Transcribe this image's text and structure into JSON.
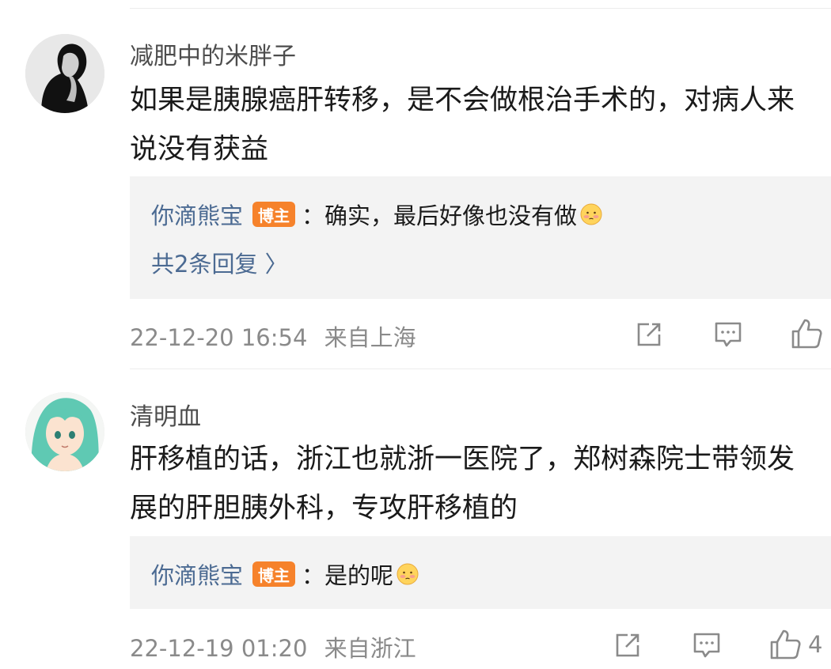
{
  "comments": [
    {
      "username": "减肥中的米胖子",
      "text": "如果是胰腺癌肝转移，是不会做根治手术的，对病人来说没有获益",
      "avatar_icon": "woman-portrait-avatar",
      "reply": {
        "user": "你滴熊宝",
        "badge": "博主",
        "text": "：确实，最后好像也没有做",
        "emoji": "blushing-emoji-icon"
      },
      "more_replies": "共2条回复 〉",
      "timestamp": "22-12-20 16:54",
      "location": "来自上海",
      "like_count": ""
    },
    {
      "username": "清明血",
      "text": "肝移植的话，浙江也就浙一医院了，郑树森院士带领发展的肝胆胰外科，专攻肝移植的",
      "avatar_icon": "anime-girl-avatar",
      "reply": {
        "user": "你滴熊宝",
        "badge": "博主",
        "text": "：是的呢",
        "emoji": "blushing-emoji-icon"
      },
      "timestamp": "22-12-19 01:20",
      "location": "来自浙江",
      "like_count": "4"
    }
  ],
  "colors": {
    "link_blue": "#4b6a92",
    "badge_orange": "#f6822b",
    "reply_bg": "#f3f3f3",
    "meta_gray": "#8a8a8a"
  }
}
